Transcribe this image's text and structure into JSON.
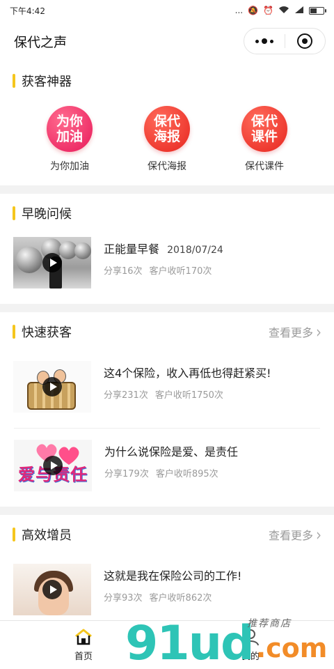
{
  "status": {
    "time": "下午4:42",
    "signal": "..."
  },
  "nav": {
    "title": "保代之声"
  },
  "sections": {
    "tools": {
      "title": "获客神器",
      "items": [
        {
          "icon_text": "为你\n加油",
          "label": "为你加油",
          "color": "#e8195a"
        },
        {
          "icon_text": "保代\n海报",
          "label": "保代海报",
          "color": "#e7261f"
        },
        {
          "icon_text": "保代\n课件",
          "label": "保代课件",
          "color": "#e7261f"
        }
      ]
    },
    "greeting": {
      "title": "早晚问候",
      "items": [
        {
          "title": "正能量早餐",
          "date": "2018/07/24",
          "shares": "分享16次",
          "listens": "客户收听170次",
          "thumb": "silver-balls-image"
        }
      ]
    },
    "fast": {
      "title": "快速获客",
      "more": "查看更多",
      "items": [
        {
          "title": "这4个保险，收入再低也得赶紧买!",
          "shares": "分享231次",
          "listens": "客户收听1750次",
          "thumb": "cartoon-barrel-image"
        },
        {
          "title": "为什么说保险是爱、是责任",
          "shares": "分享179次",
          "listens": "客户收听895次",
          "thumb": "love-responsibility-image"
        }
      ]
    },
    "growth": {
      "title": "高效增员",
      "more": "查看更多",
      "items": [
        {
          "title": "这就是我在保险公司的工作!",
          "shares": "分享93次",
          "listens": "客户收听862次",
          "thumb": "office-worker-image"
        }
      ]
    }
  },
  "tabbar": {
    "home": "首页",
    "mine": "我的"
  },
  "watermark": {
    "main": "91ud",
    "suffix": ".com",
    "tagline": "推荐商店"
  },
  "colors": {
    "accent": "#f5c61d",
    "watermark_main": "#2ec4b6",
    "watermark_suffix": "#f28c28"
  }
}
